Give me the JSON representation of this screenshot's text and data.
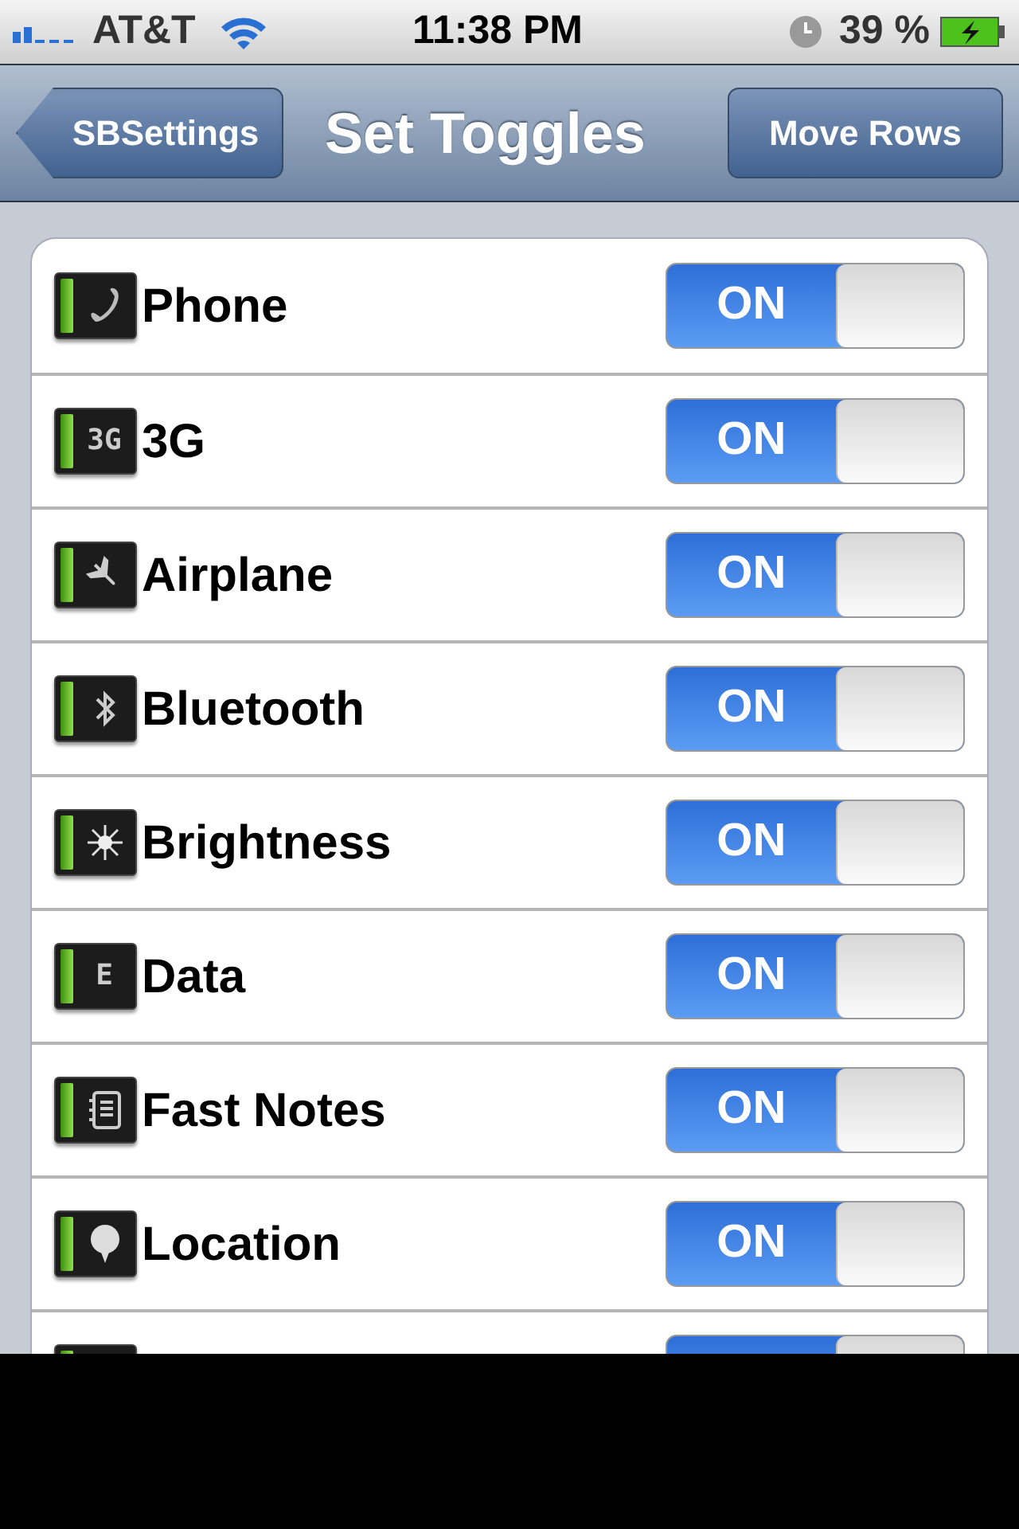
{
  "status_bar": {
    "carrier": "AT&T",
    "time": "11:38 PM",
    "battery_percent": "39 %"
  },
  "nav_bar": {
    "back_button": "SBSettings",
    "title": "Set Toggles",
    "right_button": "Move Rows"
  },
  "toggles": [
    {
      "label": "Phone",
      "kind": "phone",
      "on": true,
      "switch_label": "ON"
    },
    {
      "label": "3G",
      "kind": "text",
      "icon_text": "3G",
      "on": true,
      "switch_label": "ON"
    },
    {
      "label": "Airplane",
      "kind": "airplane",
      "on": true,
      "switch_label": "ON"
    },
    {
      "label": "Bluetooth",
      "kind": "bluetooth",
      "on": true,
      "switch_label": "ON"
    },
    {
      "label": "Brightness",
      "kind": "sun",
      "on": true,
      "switch_label": "ON"
    },
    {
      "label": "Data",
      "kind": "text",
      "icon_text": "E",
      "on": true,
      "switch_label": "ON"
    },
    {
      "label": "Fast Notes",
      "kind": "notes",
      "on": true,
      "switch_label": "ON"
    },
    {
      "label": "Location",
      "kind": "pin",
      "on": true,
      "switch_label": "ON"
    },
    {
      "kind": "blank",
      "on": true
    }
  ]
}
